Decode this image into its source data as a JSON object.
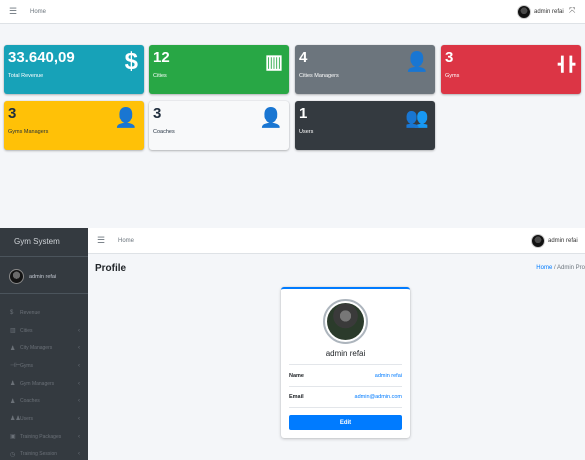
{
  "dashboard": {
    "topbar": {
      "menu_icon": "☰",
      "home_label": "Home",
      "user_name": "admin refai",
      "expand_icon": "⤧"
    },
    "boxes": [
      {
        "value": "33.640,09",
        "label": "Total Revenue",
        "icon": "dollar-icon",
        "glyph": "$",
        "color": "#17a2b8"
      },
      {
        "value": "12",
        "label": "Cities",
        "icon": "city-icon",
        "glyph": "▥",
        "color": "#28a745"
      },
      {
        "value": "4",
        "label": "Cities Managers",
        "icon": "user-tie-icon",
        "glyph": "👤",
        "color": "#6c757d"
      },
      {
        "value": "3",
        "label": "Gyms",
        "icon": "dumbbell-icon",
        "glyph": "┫┣",
        "color": "#dc3545"
      },
      {
        "value": "3",
        "label": "Gyms Managers",
        "icon": "user-icon",
        "glyph": "👤",
        "color": "#ffc107"
      },
      {
        "value": "3",
        "label": "Coaches",
        "icon": "user-ninja-icon",
        "glyph": "👤",
        "color": "#f8f9fa"
      },
      {
        "value": "1",
        "label": "Users",
        "icon": "users-icon",
        "glyph": "👥",
        "color": "#343a40"
      }
    ]
  },
  "profile_page": {
    "sidebar": {
      "brand": "Gym System",
      "user_name": "admin refai",
      "items": [
        {
          "label": "Revenue",
          "icon": "dollar-icon",
          "glyph": "$",
          "has_children": false
        },
        {
          "label": "Cities",
          "icon": "city-icon",
          "glyph": "▥",
          "has_children": true
        },
        {
          "label": "City Managers",
          "icon": "user-tie-icon",
          "glyph": "♟",
          "has_children": true
        },
        {
          "label": "Gyms",
          "icon": "dumbbell-icon",
          "glyph": "⊣⊢",
          "has_children": true
        },
        {
          "label": "Gym Managers",
          "icon": "user-icon",
          "glyph": "♟",
          "has_children": true
        },
        {
          "label": "Coaches",
          "icon": "user-ninja-icon",
          "glyph": "♟",
          "has_children": true
        },
        {
          "label": "Users",
          "icon": "users-icon",
          "glyph": "♟♟",
          "has_children": true
        },
        {
          "label": "Training Packages",
          "icon": "box-icon",
          "glyph": "▣",
          "has_children": true
        },
        {
          "label": "Training Session",
          "icon": "calendar-icon",
          "glyph": "◷",
          "has_children": true
        }
      ]
    },
    "topbar": {
      "menu_icon": "☰",
      "home_label": "Home",
      "user_name": "admin refai"
    },
    "title": "Profile",
    "breadcrumb": {
      "home": "Home",
      "separator": "/",
      "current": "Admin Pro"
    },
    "card": {
      "name": "admin refai",
      "rows": [
        {
          "label": "Name",
          "value": "admin refai"
        },
        {
          "label": "Email",
          "value": "admin@admin.com"
        }
      ],
      "edit_label": "Edit"
    }
  }
}
